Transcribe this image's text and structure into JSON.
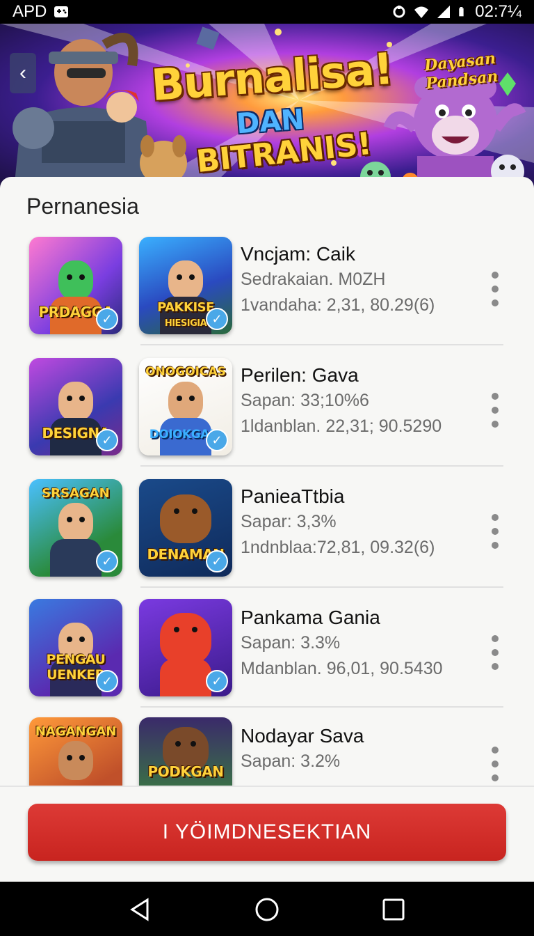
{
  "status_bar": {
    "left_text": "APD",
    "time": "02:7¼"
  },
  "hero": {
    "title": "Burnalisa!",
    "subtitle_1": "DAN",
    "subtitle_2": "BITRANIS!",
    "badge_line1": "Dayasan",
    "badge_line2": "Pandsan"
  },
  "section_title": "Pernanesia",
  "items": [
    {
      "name": "Vncjam: Caik",
      "sub": "Sedrakaian. M0ZH",
      "meta": "1vandaha: 2,31, 80.29(6)",
      "tile1_label": "PRDAGGA",
      "tile2_label": "PAKKISE",
      "tile2_sublabel": "HIESIGIA"
    },
    {
      "name": "Perilen: Gava",
      "sub": "Sapan: 33;10%6",
      "meta": "1ldanblan. 22,31; 90.5290",
      "tile1_label": "DESIGNA",
      "tile2_top": "ONOGOICAS",
      "tile2_label": "DOIOKGAIA"
    },
    {
      "name": "PanieaTtbia",
      "sub": "Sapar: 3,3%",
      "meta": "1ndnblaa:72,81, 09.32(6)",
      "tile1_top": "SRSAGAN",
      "tile2_label": "DENAMAN"
    },
    {
      "name": "Pankama Gania",
      "sub": "Sapan: 3.3%",
      "meta": "Mdanblan. 96,01, 90.5430",
      "tile1_label": "PENGAU UENKER",
      "tile2_label": ""
    },
    {
      "name": "Nodayar Sava",
      "sub": "Sapan: 3.2%",
      "meta": "",
      "tile1_top": "NAGANGAN",
      "tile2_label": "PODKGAN"
    }
  ],
  "cta_label": "I YÖIMDNESEKTIAN",
  "colors": {
    "accent": "#d5302b",
    "check": "#4aa8e8"
  }
}
